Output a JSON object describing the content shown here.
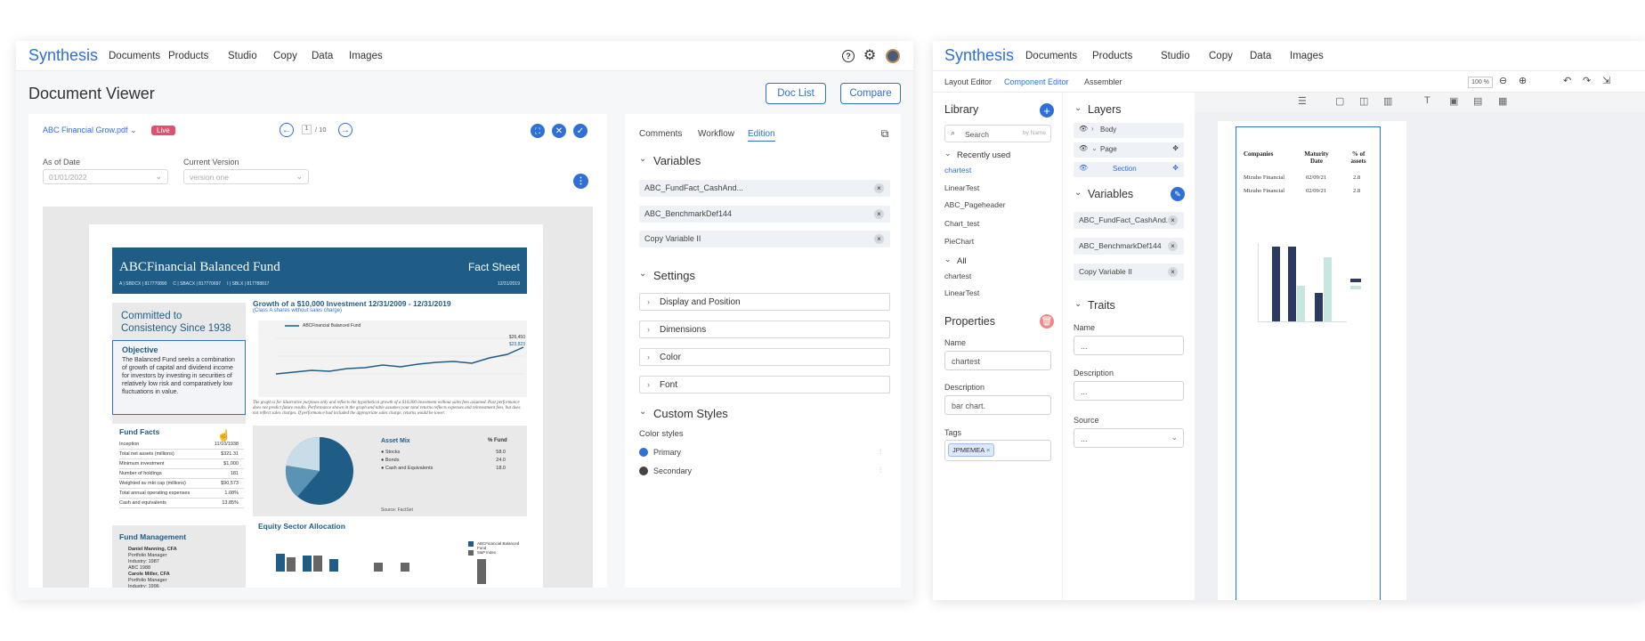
{
  "w1": {
    "brand": "Synthesis",
    "nav": [
      "Documents",
      "Products",
      "Studio",
      "Copy",
      "Data",
      "Images"
    ],
    "title": "Document Viewer",
    "doc_list": "Doc List",
    "compare": "Compare",
    "file": "ABC Financial Grow.pdf",
    "status": "Live",
    "page_current": "1",
    "page_total": "/ 10",
    "as_of_label": "As of Date",
    "as_of_value": "01/01/2022",
    "version_label": "Current Version",
    "version_value": "version one",
    "tabs": [
      "Comments",
      "Workflow",
      "Edition"
    ],
    "variables_title": "Variables",
    "variables": [
      "ABC_FundFact_CashAnd...",
      "ABC_BenchmarkDef144",
      "Copy Variable II"
    ],
    "settings_title": "Settings",
    "settings": [
      "Display and Position",
      "Dimensions",
      "Color",
      "Font"
    ],
    "custom_title": "Custom Styles",
    "color_styles": "Color styles",
    "colors": [
      {
        "name": "Primary",
        "hex": "#2f6fd6"
      },
      {
        "name": "Secondary",
        "hex": "#444444"
      }
    ],
    "sheet": {
      "fund": "ABCFinancial Balanced Fund",
      "type": "Fact Sheet",
      "tickers": "A | SBDCX | 817770890     C | SBACX | 817770697     I | SBLX | 817788817",
      "date": "12/31/2019",
      "tagline": "Committed to Consistency Since 1938",
      "objective_title": "Objective",
      "objective": "The Balanced Fund seeks a combination of growth of capital and dividend income for investors by investing in securities of relatively low risk and comparatively low fluctuations in value.",
      "growth_title": "Growth of a $10,000 Investment 12/31/2009 - 12/31/2019",
      "growth_sub": "(Class A shares without sales charge)",
      "growth_legend": "ABCFinancial Balanced Fund",
      "growth_v1": "$26,450",
      "growth_v2": "$23,823",
      "disclaimer": "The graph is for illustrative purposes only and reflects the hypothetical growth of a $10,000 investment without sales fees assumed. Past performance does not predict future results. Performance shown in the graph and table assumes your total returns reflects expenses and reinvestment fees, but does not reflect sales charges. If performance had included the appropriate sales charge, returns would be lower.",
      "facts_title": "Fund Facts",
      "facts": [
        [
          "Inception",
          "11/10/1938"
        ],
        [
          "Total net assets (millions)",
          "$321.31"
        ],
        [
          "Minimum investment",
          "$1,000"
        ],
        [
          "Number of holdings",
          "181"
        ],
        [
          "Weighted av mkt cap (millions)",
          "$90,573"
        ],
        [
          "Total annual operating expenses",
          "1.08%"
        ],
        [
          "Cash and equivalents",
          "13.85%"
        ]
      ],
      "asset_title": "Asset Mix",
      "fund_col": "% Fund",
      "assets": [
        [
          "Stocks",
          "58.0"
        ],
        [
          "Bonds",
          "24.0"
        ],
        [
          "Cash and Equivalents",
          "18.0"
        ]
      ],
      "source": "Source: FactSet",
      "mgmt_title": "Fund Management",
      "mgmt": [
        "Daniel Manning, CFA",
        "Portfolio Manager",
        "Industry: 1987",
        "ABC 1988",
        "Carole Miller, CFA",
        "Portfolio Manager",
        "Industry: 1996"
      ],
      "sector_title": "Equity Sector Allocation",
      "sector_legend1": "ABCFinancial Balanced Fund",
      "sector_legend2": "S&P Index"
    }
  },
  "w2": {
    "brand": "Synthesis",
    "nav": [
      "Documents",
      "Products",
      "Studio",
      "Copy",
      "Data",
      "Images"
    ],
    "subnav": [
      "Layout Editor",
      "Component Editor",
      "Assembler"
    ],
    "zoom": "100 %",
    "library_title": "Library",
    "search_placeholder": "Search",
    "search_by": "by Name",
    "recent_title": "Recently used",
    "recent": [
      "chartest",
      "LinearTest",
      "ABC_Pageheader",
      "Chart_test",
      "PieChart"
    ],
    "all_title": "All",
    "all": [
      "chartest",
      "LinearTest"
    ],
    "props_title": "Properties",
    "name_label": "Name",
    "name_value": "chartest",
    "desc_label": "Description",
    "desc_value": "bar chart.",
    "tags_label": "Tags",
    "tag": "JPMEMEA",
    "layers_title": "Layers",
    "layers": [
      "Body",
      "Page",
      "Section"
    ],
    "variables_title": "Variables",
    "variables": [
      "ABC_FundFact_CashAnd...",
      "ABC_BenchmarkDef144",
      "Copy Variable II"
    ],
    "traits_title": "Traits",
    "trait_name": "Name",
    "trait_desc": "Description",
    "trait_source": "Source",
    "placeholder": "...",
    "table_headers": [
      "Companies",
      "Maturity Date",
      "% of assets"
    ],
    "table_rows": [
      [
        "Mizuho Financial",
        "02/09/21",
        "2.8"
      ],
      [
        "Mizuho Financial",
        "02/09/21",
        "2.8"
      ]
    ]
  }
}
